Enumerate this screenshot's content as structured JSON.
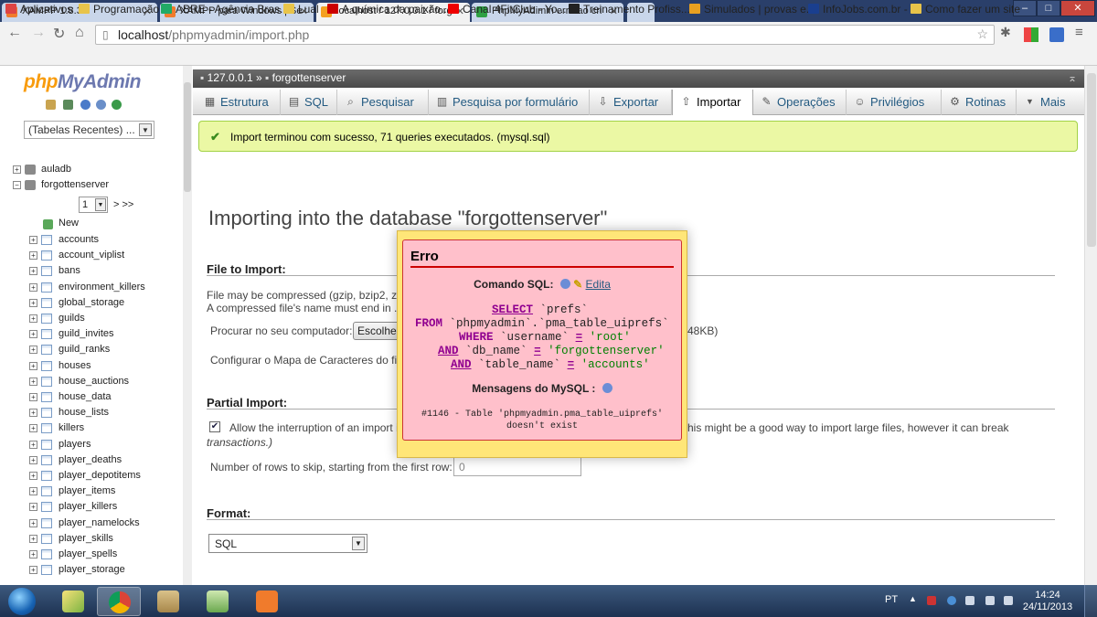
{
  "browser": {
    "tabs": [
      {
        "title": "XAMPP 1.8.3",
        "active": false,
        "icon_color": "#f07b2c"
      },
      {
        "title": "XAMPP para Windows | Se",
        "active": false,
        "icon_color": "#f07b2c"
      },
      {
        "title": "localhost / 127.0.0.1 / forg",
        "active": true,
        "icon_color": "#f4a020"
      },
      {
        "title": "PhpMyAdimin erro ao cri",
        "active": false,
        "icon_color": "#2ea043"
      }
    ],
    "window_controls": {
      "minimize": "–",
      "maximize": "□",
      "close": "✕"
    },
    "url_host": "localhost",
    "url_path": "/phpmyadmin/import.php",
    "bookmarks": [
      {
        "label": "Aplicativos",
        "icon_color": "#d44"
      },
      {
        "label": "Programação",
        "icon_color": "#e8c44a"
      },
      {
        "label": "ABRE - Agência Bras...",
        "icon_color": "#2a6"
      },
      {
        "label": "Lual",
        "icon_color": "#e8c44a"
      },
      {
        "label": "A química da paixão...",
        "icon_color": "#c00"
      },
      {
        "label": "Canal 4FitClub - Yo...",
        "icon_color": "#e00"
      },
      {
        "label": "Treinamento Profiss...",
        "icon_color": "#222"
      },
      {
        "label": "Simulados | provas e...",
        "icon_color": "#e8a020"
      },
      {
        "label": "InfoJobs.com.br -",
        "icon_color": "#1a3f8f"
      },
      {
        "label": "Como fazer um site",
        "icon_color": "#e8c44a"
      }
    ]
  },
  "sidebar": {
    "logo_php": "php",
    "logo_myadmin": "MyAdmin",
    "recent_tables": "(Tabelas Recentes) ...",
    "databases": [
      {
        "name": "auladb"
      },
      {
        "name": "forgottenserver"
      }
    ],
    "page_select": "1",
    "page_next": "> >>",
    "new_label": "New",
    "tables": [
      "accounts",
      "account_viplist",
      "bans",
      "environment_killers",
      "global_storage",
      "guilds",
      "guild_invites",
      "guild_ranks",
      "houses",
      "house_auctions",
      "house_data",
      "house_lists",
      "killers",
      "players",
      "player_deaths",
      "player_depotitems",
      "player_items",
      "player_killers",
      "player_namelocks",
      "player_skills",
      "player_spells",
      "player_storage"
    ]
  },
  "main": {
    "breadcrumb_server": "127.0.0.1",
    "breadcrumb_sep": "»",
    "breadcrumb_db": "forgottenserver",
    "tabs": [
      {
        "label": "Estrutura",
        "icon": "structure-icon",
        "glyph": "▦"
      },
      {
        "label": "SQL",
        "icon": "sql-icon",
        "glyph": "▤"
      },
      {
        "label": "Pesquisar",
        "icon": "search-icon",
        "glyph": "⌕"
      },
      {
        "label": "Pesquisa por formulário",
        "icon": "query-icon",
        "glyph": "▥"
      },
      {
        "label": "Exportar",
        "icon": "export-icon",
        "glyph": "⇩"
      },
      {
        "label": "Importar",
        "icon": "import-icon",
        "glyph": "⇧"
      },
      {
        "label": "Operações",
        "icon": "wrench-icon",
        "glyph": "✎"
      },
      {
        "label": "Privilégios",
        "icon": "users-icon",
        "glyph": "☺"
      },
      {
        "label": "Rotinas",
        "icon": "gear-icon",
        "glyph": "⚙"
      },
      {
        "label": "Mais",
        "icon": "more-icon",
        "glyph": "▼"
      }
    ],
    "active_tab": "Importar",
    "success_message": "Import terminou com sucesso, 71 queries executados. (mysql.sql)",
    "page_title": "Importing into the database \"forgottenserver\"",
    "file_to_import": {
      "heading": "File to Import:",
      "compress_note": "File may be compressed (gzip, bzip2, zip",
      "compress_note2": "A compressed file's name must end in .[f",
      "browse_label": "Procurar no seu computador:",
      "browse_button": "Escolher",
      "max_size": "48KB)",
      "charset_label": "Configurar o Mapa de Caracteres do fich"
    },
    "partial_import": {
      "heading": "Partial Import:",
      "allow_interrupt": "Allow the interruption of an import in",
      "allow_interrupt_tail": "his might be a good way to import large files, however it can break",
      "allow_interrupt_tail2": "transactions.)",
      "checked": true,
      "rows_label": "Number of rows to skip, starting from the first row:",
      "rows_value": "0"
    },
    "format": {
      "heading": "Format:",
      "selected": "SQL"
    }
  },
  "error_dialog": {
    "title": "Erro",
    "sql_label": "Comando SQL:",
    "edit_link": "Edita",
    "sql": {
      "select_kw": "SELECT",
      "select_field": "`prefs`",
      "from_kw": "FROM",
      "from_table": "`phpmyadmin`.`pma_table_uiprefs`",
      "where_kw": "WHERE",
      "where_field": "`username`",
      "eq": "=",
      "where_val": "'root'",
      "and_kw": "AND",
      "and1_field": "`db_name`",
      "and1_val": "'forgottenserver'",
      "and2_field": "`table_name`",
      "and2_val": "'accounts'"
    },
    "mysql_label": "Mensagens do MySQL :",
    "mysql_message_1": "#1146 - Table 'phpmyadmin.pma_table_uiprefs'",
    "mysql_message_2": "doesn't exist"
  },
  "taskbar": {
    "lang": "PT",
    "time": "14:24",
    "date": "24/11/2013"
  }
}
